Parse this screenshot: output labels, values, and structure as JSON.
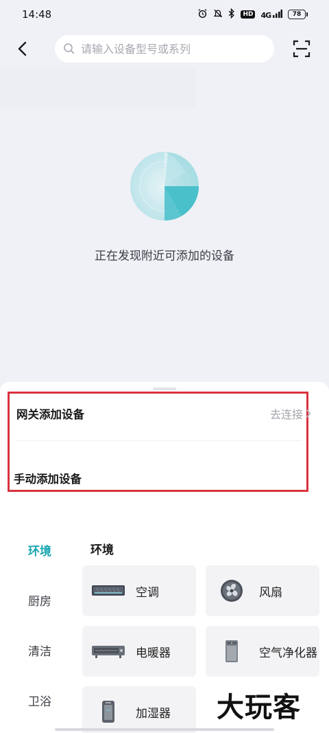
{
  "status_bar": {
    "time": "14:48",
    "hd": "HD",
    "signal": "4G",
    "battery": "78"
  },
  "search": {
    "placeholder": "请输入设备型号或系列"
  },
  "discovery": {
    "text": "正在发现附近可添加的设备"
  },
  "sheet": {
    "gateway": {
      "title": "网关添加设备",
      "action": "去连接"
    },
    "manual": {
      "title": "手动添加设备"
    }
  },
  "categories": {
    "items": [
      {
        "label": "环境",
        "active": true
      },
      {
        "label": "厨房",
        "active": false
      },
      {
        "label": "清洁",
        "active": false
      },
      {
        "label": "卫浴",
        "active": false
      }
    ],
    "section_title": "环境",
    "devices": [
      {
        "label": "空调",
        "icon": "air-conditioner-icon"
      },
      {
        "label": "风扇",
        "icon": "fan-icon"
      },
      {
        "label": "电暖器",
        "icon": "heater-icon"
      },
      {
        "label": "空气净化器",
        "icon": "air-purifier-icon"
      },
      {
        "label": "加湿器",
        "icon": "humidifier-icon"
      }
    ]
  },
  "watermark": {
    "text": "大玩客"
  },
  "colors": {
    "accent": "#1aa6b1",
    "highlight": "#d9323f",
    "background": "#f0f1f6"
  }
}
